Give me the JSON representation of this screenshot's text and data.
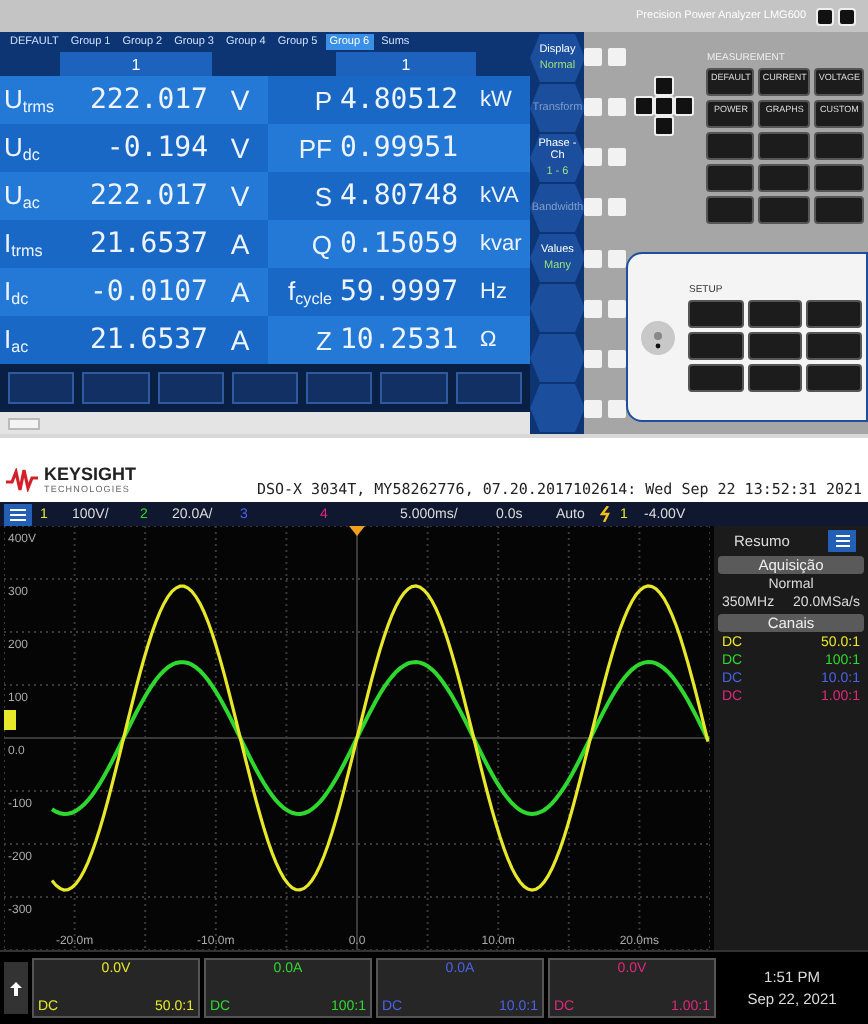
{
  "analyzer": {
    "title": "Precision Power Analyzer LMG600",
    "tabs": [
      {
        "label": "DEFAULT",
        "selected": false
      },
      {
        "label": "Group 1",
        "selected": false
      },
      {
        "label": "Group 2",
        "selected": false
      },
      {
        "label": "Group 3",
        "selected": false
      },
      {
        "label": "Group 4",
        "selected": false
      },
      {
        "label": "Group 5",
        "selected": false
      },
      {
        "label": "Group 6",
        "selected": true
      },
      {
        "label": "Sums",
        "selected": false
      }
    ],
    "column_headers": [
      "1",
      "1"
    ],
    "rows": [
      {
        "quantity": "U$_{trms}$",
        "value": "222.017",
        "unit": "V",
        "quantity_2": "P",
        "value_2": "4.80512",
        "unit_2": "kW"
      },
      {
        "quantity": "U$_{dc}$",
        "value": "-0.194",
        "unit": "V",
        "quantity_2": "PF",
        "value_2": "0.99951"
      },
      {
        "quantity": "U$_{ac}$",
        "value": "222.017",
        "unit": "V",
        "quantity_2": "S",
        "value_2": "4.80748",
        "unit_2": "kVA"
      },
      {
        "quantity": "I$_{trms}$",
        "value": "21.6537",
        "unit": "A",
        "quantity_2": "Q",
        "value_2": "0.15059",
        "unit_2": "kvar"
      },
      {
        "quantity": "I$_{dc}$",
        "value": "-0.0107",
        "unit": "A",
        "quantity_2": "f$_{cycle}$",
        "value_2": "59.9997",
        "unit_2": "Hz"
      },
      {
        "quantity": "I$_{ac}$",
        "value": "21.6537",
        "unit": "A",
        "quantity_2": "Z",
        "value_2": "10.2531",
        "unit_2": "Ω"
      }
    ],
    "softkeys": [
      {
        "label": "Display",
        "value": "Normal",
        "disabled": false
      },
      {
        "label": "Transform",
        "disabled": true
      },
      {
        "label": "Phase - Ch",
        "value": "1 - 6",
        "disabled": false
      },
      {
        "label": "Bandwidth",
        "disabled": true
      },
      {
        "label": "Values",
        "value": "Many",
        "disabled": false
      }
    ],
    "measurement": {
      "heading": "MEASUREMENT",
      "buttons": [
        "DEFAULT",
        "CURRENT",
        "VOLTAGE",
        "POWER",
        "GRAPHS",
        "CUSTOM"
      ]
    },
    "setup": {
      "heading": "SETUP"
    }
  },
  "scope": {
    "brand": "KEYSIGHT",
    "brand_sub": "TECHNOLOGIES",
    "info": "DSO-X 3034T, MY58262776, 07.20.2017102614: Wed Sep 22 13:52:31 2021",
    "channels": [
      {
        "number": "1",
        "scale": "100V/",
        "color": "#e8e82a",
        "coupling": "DC",
        "ratio": "50.0:1"
      },
      {
        "number": "2",
        "scale": "20.0A/",
        "color": "#2fd82f",
        "coupling": "DC",
        "ratio": "100:1"
      },
      {
        "number": "3",
        "color": "#4a62e8",
        "coupling": "DC",
        "ratio": "10.0:1"
      },
      {
        "number": "4",
        "color": "#e0287a",
        "coupling": "DC",
        "ratio": "1.00:1"
      }
    ],
    "timebase": "5.000ms/",
    "delay": "0.0s",
    "trigger_mode": "Auto",
    "trigger_source": "1",
    "trigger_level": "-4.00V",
    "y_labels": [
      "400V",
      "300",
      "200",
      "100",
      "0.0",
      "-100",
      "-200",
      "-300"
    ],
    "x_labels": [
      "-20.0m",
      "-10.0m",
      "0.0",
      "10.0m",
      "20.0ms"
    ],
    "panel": {
      "title": "Resumo",
      "acquisition_heading": "Aquisição",
      "acquisition_mode": "Normal",
      "bandwidth": "350MHz",
      "sample_rate": "20.0MSa/s",
      "channels_heading": "Canais"
    },
    "channel_boxes": [
      {
        "offset": "0.0V",
        "coupling": "DC",
        "ratio": "50.0:1"
      },
      {
        "offset": "0.0A",
        "coupling": "DC",
        "ratio": "100:1"
      },
      {
        "offset": "0.0A",
        "coupling": "DC",
        "ratio": "10.0:1"
      },
      {
        "offset": "0.0V",
        "coupling": "DC",
        "ratio": "1.00:1"
      }
    ],
    "time": "1:51 PM",
    "date": "Sep 22, 2021"
  }
}
